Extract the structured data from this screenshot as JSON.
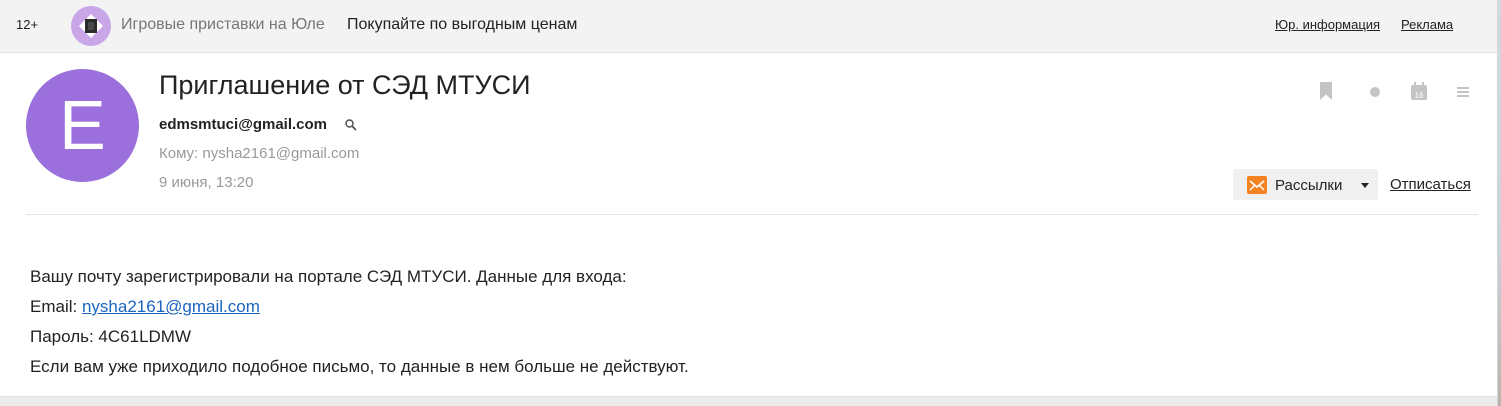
{
  "ad": {
    "age_rating": "12+",
    "source": "Игровые приставки на Юле",
    "slogan": "Покупайте по выгодным ценам",
    "legal_link": "Юр. информация",
    "ads_link": "Реклама"
  },
  "letter": {
    "avatar_letter": "E",
    "subject": "Приглашение от СЭД МТУСИ",
    "sender": "edmsmtuci@gmail.com",
    "recipient": "Кому: nysha2161@gmail.com",
    "date": "9 июня, 13:20",
    "calendar_day": "16",
    "mailing_button": "Рассылки",
    "unsubscribe": "Отписаться"
  },
  "body": {
    "line1": "Вашу почту зарегистрировали на портале СЭД МТУСИ. Данные для входа:",
    "email_label": "Email: ",
    "email_value": "nysha2161@gmail.com",
    "password_line": "Пароль: 4C61LDMW",
    "line4": "Если вам уже приходило подобное письмо, то данные в нем больше не действуют."
  },
  "colors": {
    "avatar": "#9b70dc",
    "link": "#1a65c0",
    "mailing_icon": "#f58220"
  },
  "icons": [
    "gamepad-logo-icon",
    "search-icon",
    "bookmark-icon",
    "dot-icon",
    "calendar-icon",
    "menu-icon",
    "mailing-envelope-icon",
    "dropdown-arrow-icon"
  ]
}
